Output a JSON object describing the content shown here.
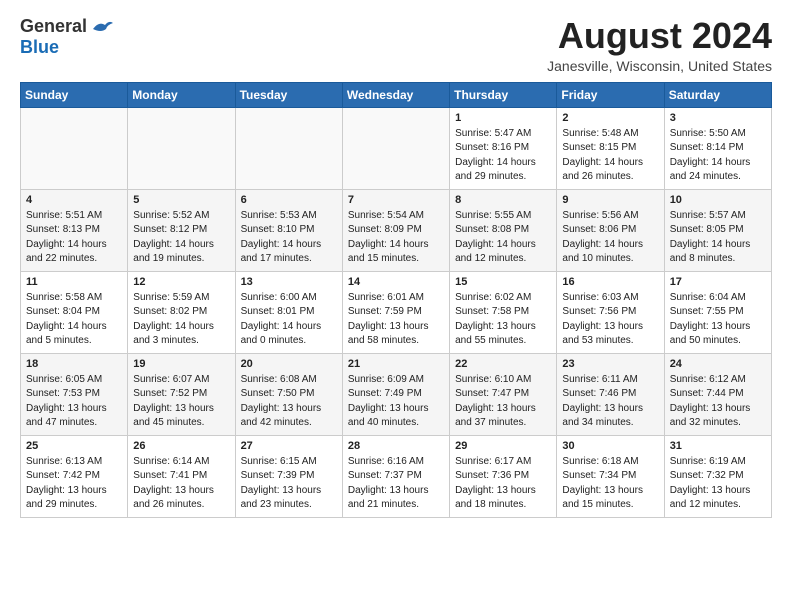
{
  "header": {
    "logo_general": "General",
    "logo_blue": "Blue",
    "month_year": "August 2024",
    "location": "Janesville, Wisconsin, United States"
  },
  "days_of_week": [
    "Sunday",
    "Monday",
    "Tuesday",
    "Wednesday",
    "Thursday",
    "Friday",
    "Saturday"
  ],
  "weeks": [
    {
      "cells": [
        {
          "day": "",
          "content": ""
        },
        {
          "day": "",
          "content": ""
        },
        {
          "day": "",
          "content": ""
        },
        {
          "day": "",
          "content": ""
        },
        {
          "day": "1",
          "content": "Sunrise: 5:47 AM\nSunset: 8:16 PM\nDaylight: 14 hours\nand 29 minutes."
        },
        {
          "day": "2",
          "content": "Sunrise: 5:48 AM\nSunset: 8:15 PM\nDaylight: 14 hours\nand 26 minutes."
        },
        {
          "day": "3",
          "content": "Sunrise: 5:50 AM\nSunset: 8:14 PM\nDaylight: 14 hours\nand 24 minutes."
        }
      ]
    },
    {
      "cells": [
        {
          "day": "4",
          "content": "Sunrise: 5:51 AM\nSunset: 8:13 PM\nDaylight: 14 hours\nand 22 minutes."
        },
        {
          "day": "5",
          "content": "Sunrise: 5:52 AM\nSunset: 8:12 PM\nDaylight: 14 hours\nand 19 minutes."
        },
        {
          "day": "6",
          "content": "Sunrise: 5:53 AM\nSunset: 8:10 PM\nDaylight: 14 hours\nand 17 minutes."
        },
        {
          "day": "7",
          "content": "Sunrise: 5:54 AM\nSunset: 8:09 PM\nDaylight: 14 hours\nand 15 minutes."
        },
        {
          "day": "8",
          "content": "Sunrise: 5:55 AM\nSunset: 8:08 PM\nDaylight: 14 hours\nand 12 minutes."
        },
        {
          "day": "9",
          "content": "Sunrise: 5:56 AM\nSunset: 8:06 PM\nDaylight: 14 hours\nand 10 minutes."
        },
        {
          "day": "10",
          "content": "Sunrise: 5:57 AM\nSunset: 8:05 PM\nDaylight: 14 hours\nand 8 minutes."
        }
      ]
    },
    {
      "cells": [
        {
          "day": "11",
          "content": "Sunrise: 5:58 AM\nSunset: 8:04 PM\nDaylight: 14 hours\nand 5 minutes."
        },
        {
          "day": "12",
          "content": "Sunrise: 5:59 AM\nSunset: 8:02 PM\nDaylight: 14 hours\nand 3 minutes."
        },
        {
          "day": "13",
          "content": "Sunrise: 6:00 AM\nSunset: 8:01 PM\nDaylight: 14 hours\nand 0 minutes."
        },
        {
          "day": "14",
          "content": "Sunrise: 6:01 AM\nSunset: 7:59 PM\nDaylight: 13 hours\nand 58 minutes."
        },
        {
          "day": "15",
          "content": "Sunrise: 6:02 AM\nSunset: 7:58 PM\nDaylight: 13 hours\nand 55 minutes."
        },
        {
          "day": "16",
          "content": "Sunrise: 6:03 AM\nSunset: 7:56 PM\nDaylight: 13 hours\nand 53 minutes."
        },
        {
          "day": "17",
          "content": "Sunrise: 6:04 AM\nSunset: 7:55 PM\nDaylight: 13 hours\nand 50 minutes."
        }
      ]
    },
    {
      "cells": [
        {
          "day": "18",
          "content": "Sunrise: 6:05 AM\nSunset: 7:53 PM\nDaylight: 13 hours\nand 47 minutes."
        },
        {
          "day": "19",
          "content": "Sunrise: 6:07 AM\nSunset: 7:52 PM\nDaylight: 13 hours\nand 45 minutes."
        },
        {
          "day": "20",
          "content": "Sunrise: 6:08 AM\nSunset: 7:50 PM\nDaylight: 13 hours\nand 42 minutes."
        },
        {
          "day": "21",
          "content": "Sunrise: 6:09 AM\nSunset: 7:49 PM\nDaylight: 13 hours\nand 40 minutes."
        },
        {
          "day": "22",
          "content": "Sunrise: 6:10 AM\nSunset: 7:47 PM\nDaylight: 13 hours\nand 37 minutes."
        },
        {
          "day": "23",
          "content": "Sunrise: 6:11 AM\nSunset: 7:46 PM\nDaylight: 13 hours\nand 34 minutes."
        },
        {
          "day": "24",
          "content": "Sunrise: 6:12 AM\nSunset: 7:44 PM\nDaylight: 13 hours\nand 32 minutes."
        }
      ]
    },
    {
      "cells": [
        {
          "day": "25",
          "content": "Sunrise: 6:13 AM\nSunset: 7:42 PM\nDaylight: 13 hours\nand 29 minutes."
        },
        {
          "day": "26",
          "content": "Sunrise: 6:14 AM\nSunset: 7:41 PM\nDaylight: 13 hours\nand 26 minutes."
        },
        {
          "day": "27",
          "content": "Sunrise: 6:15 AM\nSunset: 7:39 PM\nDaylight: 13 hours\nand 23 minutes."
        },
        {
          "day": "28",
          "content": "Sunrise: 6:16 AM\nSunset: 7:37 PM\nDaylight: 13 hours\nand 21 minutes."
        },
        {
          "day": "29",
          "content": "Sunrise: 6:17 AM\nSunset: 7:36 PM\nDaylight: 13 hours\nand 18 minutes."
        },
        {
          "day": "30",
          "content": "Sunrise: 6:18 AM\nSunset: 7:34 PM\nDaylight: 13 hours\nand 15 minutes."
        },
        {
          "day": "31",
          "content": "Sunrise: 6:19 AM\nSunset: 7:32 PM\nDaylight: 13 hours\nand 12 minutes."
        }
      ]
    }
  ]
}
